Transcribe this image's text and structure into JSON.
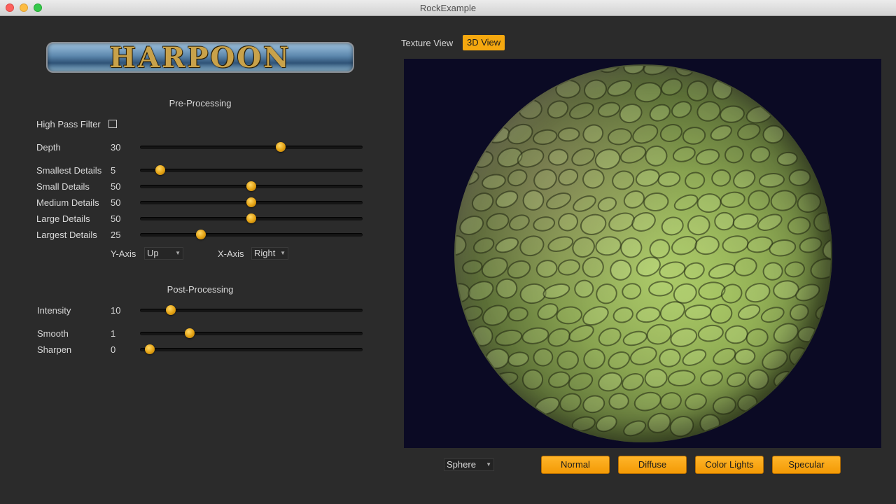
{
  "window": {
    "title": "RockExample"
  },
  "logo": {
    "text": "HARPOON"
  },
  "pre_processing": {
    "title": "Pre-Processing",
    "high_pass_label": "High Pass Filter",
    "high_pass_checked": false,
    "sliders": [
      {
        "label": "Depth",
        "value": "30",
        "level": 0.64
      },
      {
        "label": "Smallest Details",
        "value": "5",
        "level": 0.07
      },
      {
        "label": "Small Details",
        "value": "50",
        "level": 0.5
      },
      {
        "label": "Medium Details",
        "value": "50",
        "level": 0.5
      },
      {
        "label": "Large Details",
        "value": "50",
        "level": 0.5
      },
      {
        "label": "Largest Details",
        "value": "25",
        "level": 0.26
      }
    ],
    "y_axis": {
      "label": "Y-Axis",
      "value": "Up"
    },
    "x_axis": {
      "label": "X-Axis",
      "value": "Right"
    }
  },
  "post_processing": {
    "title": "Post-Processing",
    "sliders": [
      {
        "label": "Intensity",
        "value": "10",
        "level": 0.12
      },
      {
        "label": "Smooth",
        "value": "1",
        "level": 0.21
      },
      {
        "label": "Sharpen",
        "value": "0",
        "level": 0.02
      }
    ]
  },
  "tabs": [
    {
      "label": "Texture View",
      "active": false
    },
    {
      "label": "3D View",
      "active": true
    }
  ],
  "shape_select": {
    "value": "Sphere"
  },
  "buttons": [
    "Normal",
    "Diffuse",
    "Color Lights",
    "Specular"
  ],
  "colors": {
    "accent": "#f5a80f",
    "background": "#2b2b2b",
    "viewport": "#0b0a24"
  },
  "icons": {
    "close": "close-icon",
    "minimize": "minimize-icon",
    "maximize": "maximize-icon",
    "dropdown": "chevron-down-icon"
  }
}
